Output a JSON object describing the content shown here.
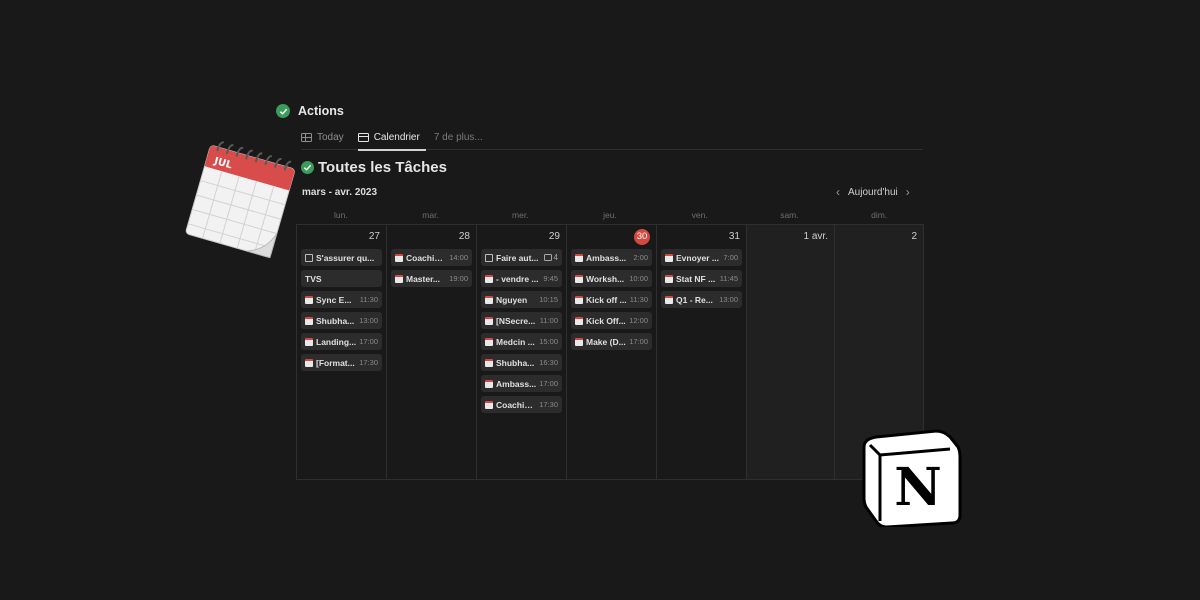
{
  "database": {
    "title": "Actions"
  },
  "tabs": [
    {
      "label": "Today",
      "icon": "table-icon"
    },
    {
      "label": "Calendrier",
      "icon": "calendar-icon",
      "active": true
    },
    {
      "label": "7 de plus..."
    }
  ],
  "view": {
    "title": "Toutes les Tâches"
  },
  "calendar": {
    "month_label": "mars - avr. 2023",
    "today_label": "Aujourd'hui",
    "weekdays": [
      "lun.",
      "mar.",
      "mer.",
      "jeu.",
      "ven.",
      "sam.",
      "dim."
    ],
    "days": [
      {
        "num": "27",
        "events": [
          {
            "title": "S'assurer qu...",
            "time": "",
            "icon": "doc"
          },
          {
            "title": "TVS",
            "time": "",
            "icon": ""
          },
          {
            "title": "Sync E...",
            "time": "11:30",
            "icon": "cal"
          },
          {
            "title": "Shubha...",
            "time": "13:00",
            "icon": "cal"
          },
          {
            "title": "Landing...",
            "time": "17:00",
            "icon": "cal"
          },
          {
            "title": "[Format...",
            "time": "17:30",
            "icon": "cal"
          }
        ]
      },
      {
        "num": "28",
        "events": [
          {
            "title": "Coachin...",
            "time": "14:00",
            "icon": "cal"
          },
          {
            "title": "Master...",
            "time": "19:00",
            "icon": "cal"
          }
        ]
      },
      {
        "num": "29",
        "events": [
          {
            "title": "Faire aut...",
            "time": "",
            "icon": "doc",
            "comments": "4"
          },
          {
            "title": "- vendre ...",
            "time": "9:45",
            "icon": "cal"
          },
          {
            "title": "Nguyen",
            "time": "10:15",
            "icon": "cal"
          },
          {
            "title": "[NSecre...",
            "time": "11:00",
            "icon": "cal"
          },
          {
            "title": "Medcin ...",
            "time": "15:00",
            "icon": "cal"
          },
          {
            "title": "Shubha...",
            "time": "16:30",
            "icon": "cal"
          },
          {
            "title": "Ambass...",
            "time": "17:00",
            "icon": "cal"
          },
          {
            "title": "Coachin...",
            "time": "17:30",
            "icon": "cal"
          }
        ]
      },
      {
        "num": "30",
        "today": true,
        "events": [
          {
            "title": "Ambass...",
            "time": "2:00",
            "icon": "cal"
          },
          {
            "title": "Worksh...",
            "time": "10:00",
            "icon": "cal"
          },
          {
            "title": "Kick off ...",
            "time": "11:30",
            "icon": "cal"
          },
          {
            "title": "Kick Off...",
            "time": "12:00",
            "icon": "cal"
          },
          {
            "title": "Make (D...",
            "time": "17:00",
            "icon": "cal"
          }
        ]
      },
      {
        "num": "31",
        "events": [
          {
            "title": "Evnoyer ...",
            "time": "7:00",
            "icon": "cal"
          },
          {
            "title": "Stat NF ...",
            "time": "11:45",
            "icon": "cal"
          },
          {
            "title": "Q1 - Re...",
            "time": "13:00",
            "icon": "cal"
          }
        ]
      },
      {
        "num": "1 avr.",
        "weekend": true,
        "events": []
      },
      {
        "num": "2",
        "weekend": true,
        "events": []
      }
    ]
  },
  "colors": {
    "background": "#191919",
    "today": "#d3483f",
    "check": "#3a9b5c"
  },
  "decor": {
    "calendar_illustration": {
      "icon": "calendar-illustration-icon",
      "month_text": "JUL"
    },
    "notion_logo": {
      "icon": "notion-logo-icon",
      "letter": "N"
    }
  }
}
